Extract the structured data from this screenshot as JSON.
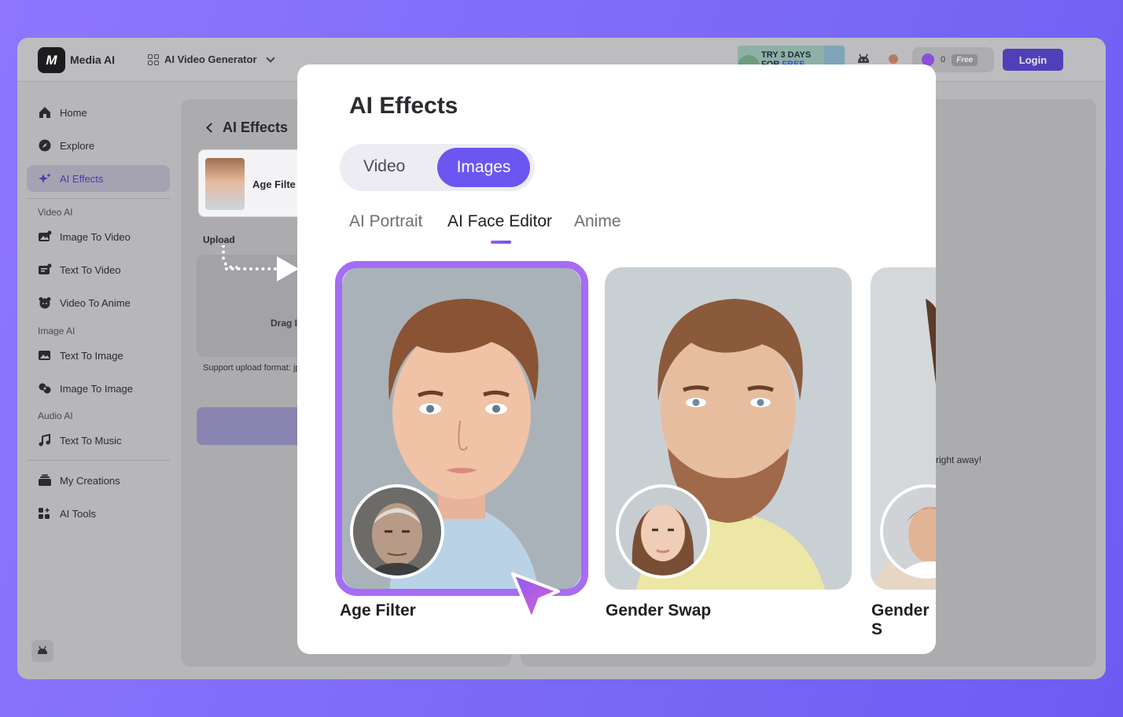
{
  "app": {
    "logo_text": "Media AI",
    "logo_glyph": "M",
    "product_selector": "AI Video Generator",
    "trial_line1": "TRY 3 DAYS",
    "trial_line2_a": "FOR ",
    "trial_line2_b": "FREE",
    "credits": "0",
    "plan_badge": "Free",
    "login_label": "Login"
  },
  "sidebar": {
    "items": [
      {
        "label": "Home",
        "icon": "home-icon"
      },
      {
        "label": "Explore",
        "icon": "compass-icon"
      },
      {
        "label": "AI Effects",
        "icon": "sparkle-icon"
      },
      {
        "label": "Image To Video",
        "icon": "image-video-icon"
      },
      {
        "label": "Text To Video",
        "icon": "text-video-icon"
      },
      {
        "label": "Video To Anime",
        "icon": "anime-icon"
      },
      {
        "label": "Text To Image",
        "icon": "text-image-icon"
      },
      {
        "label": "Image To Image",
        "icon": "image-image-icon"
      },
      {
        "label": "Text To Music",
        "icon": "music-icon"
      },
      {
        "label": "My Creations",
        "icon": "creations-icon"
      },
      {
        "label": "AI Tools",
        "icon": "tools-icon"
      }
    ],
    "sections": {
      "video_ai": "Video AI",
      "image_ai": "Image AI",
      "audio_ai": "Audio AI"
    }
  },
  "left_panel": {
    "title": "AI Effects",
    "effect_name": "Age Filte",
    "upload_label": "Upload",
    "drop_text": "Drag I",
    "support_text": "Support upload format: jp"
  },
  "right_panel": {
    "hint": "right away!"
  },
  "modal": {
    "title": "AI Effects",
    "segments": [
      "Video",
      "Images"
    ],
    "active_segment": "Images",
    "subtabs": [
      "AI Portrait",
      "AI Face Editor",
      "Anime"
    ],
    "active_subtab": "AI Face Editor",
    "cards": [
      {
        "label": "Age Filter"
      },
      {
        "label": "Gender Swap"
      },
      {
        "label": "Gender S"
      }
    ]
  },
  "colors": {
    "accent": "#6b56f2",
    "selection": "#a56cf5",
    "background_gradient_start": "#8e76ff",
    "background_gradient_end": "#6c5cf2"
  }
}
